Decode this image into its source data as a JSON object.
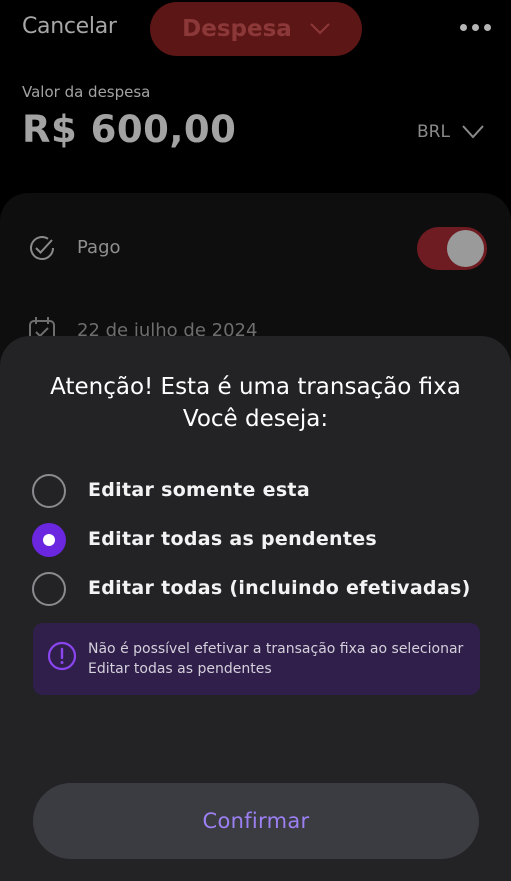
{
  "header": {
    "cancel_label": "Cancelar",
    "type_label": "Despesa",
    "more_icon": "more-horizontal-icon"
  },
  "expense": {
    "value_label": "Valor da despesa",
    "amount": "R$ 600,00",
    "currency": "BRL"
  },
  "form": {
    "paid_label": "Pago",
    "paid_on": true,
    "date_label": "22 de julho de 2024"
  },
  "sheet": {
    "title": "Atenção! Esta é uma transação fixa",
    "subtitle": "Você deseja:",
    "options": [
      {
        "label": "Editar somente esta",
        "selected": false
      },
      {
        "label": "Editar todas as pendentes",
        "selected": true
      },
      {
        "label": "Editar todas (incluindo efetivadas)",
        "selected": false
      }
    ],
    "alert_text": "Não é possível efetivar a transação fixa ao selecionar Editar todas as pendentes",
    "confirm_label": "Confirmar"
  },
  "colors": {
    "accent": "#6b26e0",
    "expense_red": "#5c1616",
    "sheet_bg": "#232326",
    "alert_bg": "#2f1f4a",
    "confirm_text": "#9c80f2"
  }
}
